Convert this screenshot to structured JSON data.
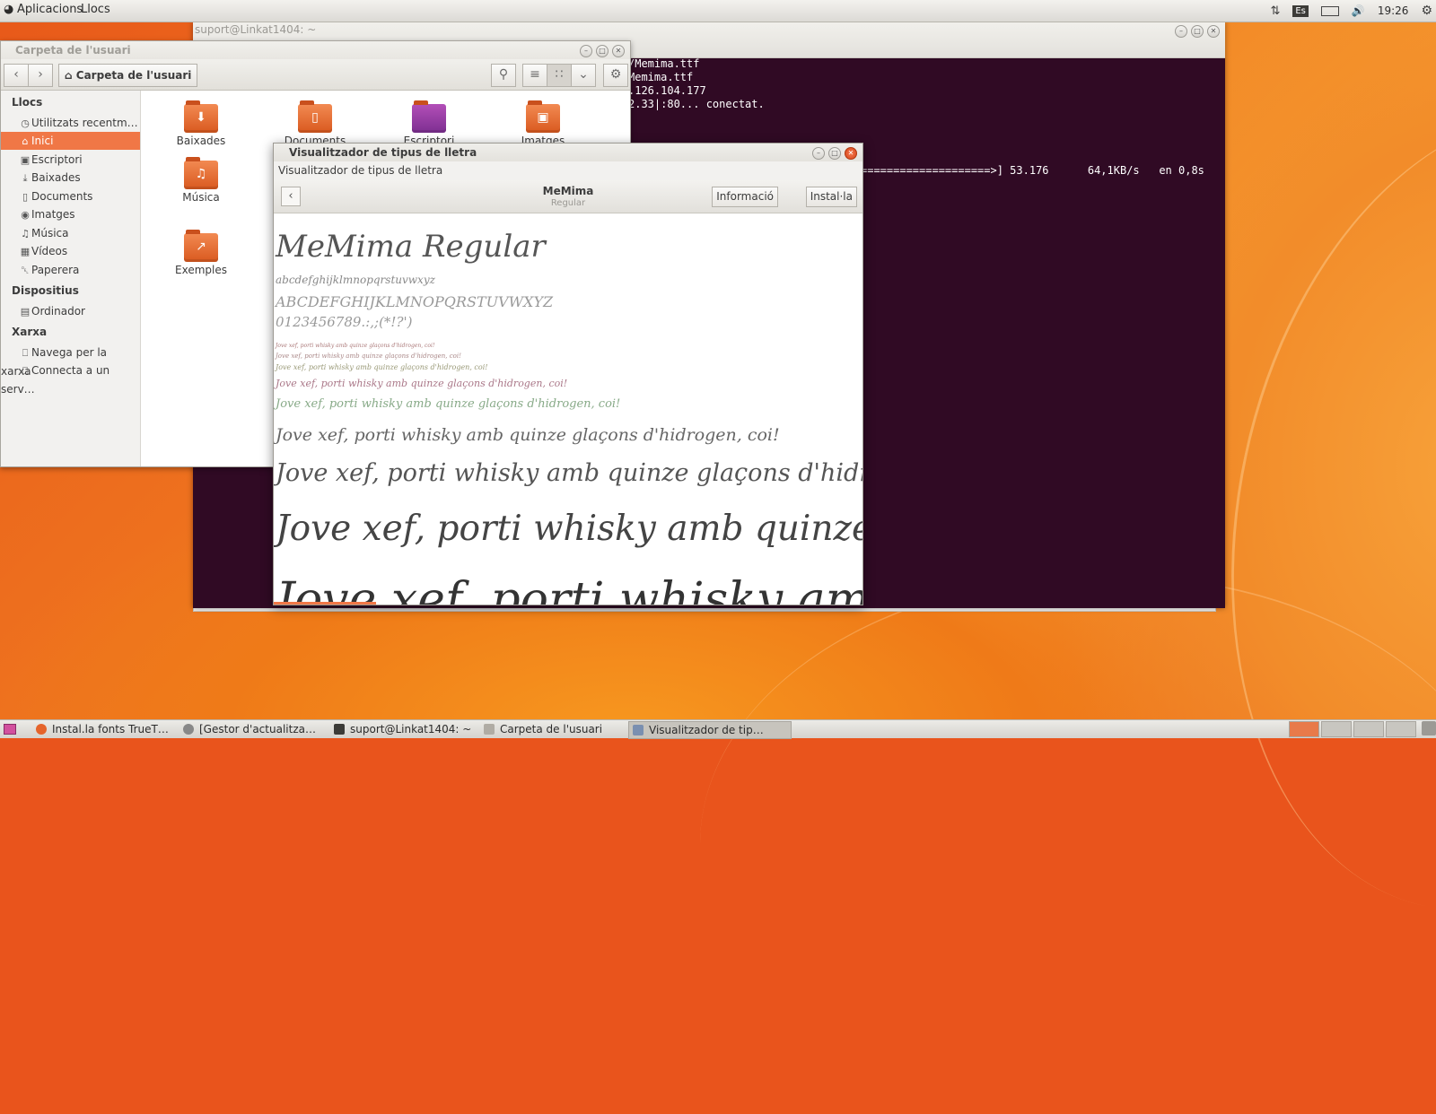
{
  "top_panel": {
    "applications": "Aplicacions",
    "places": "Llocs",
    "keyboard_layout": "Es",
    "clock": "19:26"
  },
  "terminal": {
    "title": "suport@Linkat1404: ~",
    "lines": [
      "/Memima.ttf",
      "Memima.ttf",
      ".126.104.177",
      "2.33|:80... conectat.",
      "",
      "",
      "",
      "",
      "====================>] 53.176      64,1KB/s   en 0,8s"
    ]
  },
  "file_manager": {
    "title": "Carpeta de l'usuari",
    "path_button": "Carpeta de l'usuari",
    "sidebar": {
      "places_heading": "Llocs",
      "places": [
        {
          "label": "Utilitzats recentm…",
          "icon": "clock-icon"
        },
        {
          "label": "Inici",
          "icon": "home-icon",
          "selected": true
        },
        {
          "label": "Escriptori",
          "icon": "desktop-icon"
        },
        {
          "label": "Baixades",
          "icon": "download-icon"
        },
        {
          "label": "Documents",
          "icon": "document-icon"
        },
        {
          "label": "Imatges",
          "icon": "camera-icon"
        },
        {
          "label": "Música",
          "icon": "music-icon"
        },
        {
          "label": "Vídeos",
          "icon": "film-icon"
        },
        {
          "label": "Paperera",
          "icon": "trash-icon"
        }
      ],
      "devices_heading": "Dispositius",
      "devices": [
        {
          "label": "Ordinador",
          "icon": "drive-icon"
        }
      ],
      "network_heading": "Xarxa",
      "network": [
        {
          "label": "Navega per la xarxa",
          "icon": "network-icon"
        },
        {
          "label": "Connecta a un serv…",
          "icon": "server-icon"
        }
      ]
    },
    "folders": [
      {
        "label": "Baixades",
        "icon": "download-folder-icon"
      },
      {
        "label": "Documents",
        "icon": "documents-folder-icon"
      },
      {
        "label": "Escriptori",
        "icon": "desktop-folder-icon"
      },
      {
        "label": "Imatges",
        "icon": "pictures-folder-icon"
      },
      {
        "label": "Música",
        "icon": "music-folder-icon"
      },
      {
        "label": "Exemples",
        "icon": "examples-folder-icon"
      }
    ]
  },
  "font_viewer": {
    "title": "Visualitzador de tipus de lletra",
    "menu_label": "Visualitzador de tipus de lletra",
    "font_name": "MeMima",
    "font_style": "Regular",
    "info_button": "Informació",
    "install_button": "Instal·la",
    "preview": {
      "heading": "MeMima Regular",
      "lowercase": "abcdefghijklmnopqrstuvwxyz",
      "uppercase": "ABCDEFGHIJKLMNOPQRSTUVWXYZ",
      "digits": "0123456789.:,;(*!?')",
      "pangram": "Jove xef, porti whisky amb quinze glaçons d'hidrogen, coi!"
    }
  },
  "taskbar": {
    "tasks": [
      {
        "label": "Instal.la fonts TrueT…",
        "color": "#e5642b"
      },
      {
        "label": "[Gestor d'actualitza…",
        "color": "#888888"
      },
      {
        "label": "suport@Linkat1404: ~",
        "color": "#3c3b37"
      },
      {
        "label": "Carpeta de l'usuari",
        "color": "#b0aca4"
      },
      {
        "label": "Visualitzador de tip…",
        "color": "#7a8fb0",
        "active": true
      }
    ]
  }
}
